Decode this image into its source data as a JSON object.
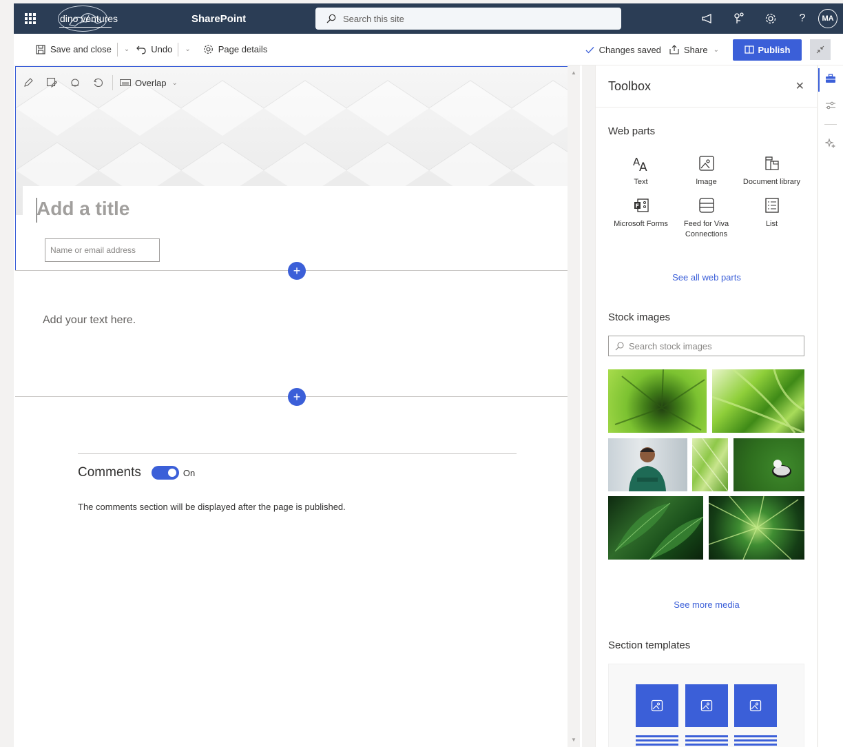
{
  "suitebar": {
    "logo_text": "dino ventures",
    "app_name": "SharePoint",
    "search_placeholder": "Search this site",
    "avatar_initials": "MA",
    "help_label": "?"
  },
  "commandbar": {
    "save_label": "Save and close",
    "undo_label": "Undo",
    "page_details_label": "Page details",
    "status_text": "Changes saved",
    "share_label": "Share",
    "publish_label": "Publish"
  },
  "hero": {
    "layout_label": "Overlap",
    "title_placeholder": "Add a title",
    "author_placeholder": "Name or email address"
  },
  "body": {
    "text_placeholder": "Add your text here."
  },
  "comments": {
    "title": "Comments",
    "toggle_state": "On",
    "note": "The comments section will be displayed after the page is published."
  },
  "toolbox": {
    "title": "Toolbox",
    "web_parts_heading": "Web parts",
    "web_parts": [
      {
        "label": "Text",
        "icon": "text-icon"
      },
      {
        "label": "Image",
        "icon": "image-icon"
      },
      {
        "label": "Document library",
        "icon": "document-library-icon"
      },
      {
        "label": "Microsoft Forms",
        "icon": "forms-icon"
      },
      {
        "label": "Feed for Viva Connections",
        "icon": "feed-icon"
      },
      {
        "label": "List",
        "icon": "list-icon"
      }
    ],
    "see_all_label": "See all web parts",
    "stock_heading": "Stock images",
    "stock_search_placeholder": "Search stock images",
    "see_more_label": "See more media",
    "templates_heading": "Section templates"
  },
  "colors": {
    "suitebar_bg": "#2b3d55",
    "accent": "#3b5fd8"
  }
}
